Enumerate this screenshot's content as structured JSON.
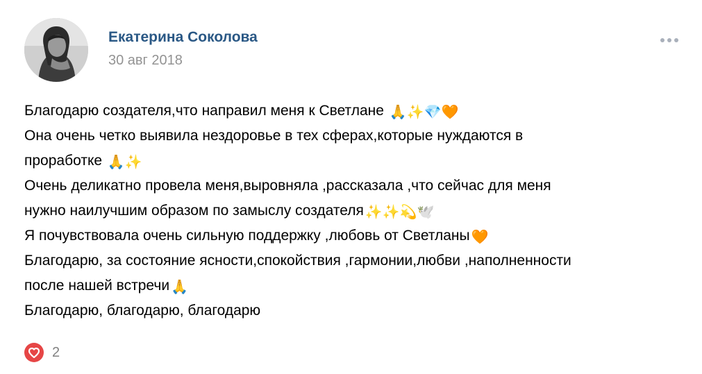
{
  "post": {
    "author": "Екатерина Соколова",
    "date": "30 авг 2018",
    "lines": [
      {
        "text": "Благодарю создателя,что направил меня к Светлане ",
        "emoji": "🙏✨💎🧡"
      },
      {
        "text": "Она очень четко выявила нездоровье в тех сферах,которые нуждаются в",
        "emoji": ""
      },
      {
        "text": "проработке ",
        "emoji": "🙏✨"
      },
      {
        "text": "Очень деликатно провела меня,выровняла ,рассказала ,что сейчас для меня",
        "emoji": ""
      },
      {
        "text": "нужно наилучшим образом по замыслу создателя",
        "emoji": "✨✨💫🕊️"
      },
      {
        "text": "Я почувствовала очень сильную поддержку ,любовь от Светланы",
        "emoji": "🧡"
      },
      {
        "text": "Благодарю, за состояние ясности,спокойствия ,гармонии,любви ,наполненности",
        "emoji": ""
      },
      {
        "text": "после нашей встречи",
        "emoji": "🙏"
      },
      {
        "text": "Благодарю, благодарю, благодарю",
        "emoji": ""
      }
    ],
    "likes": "2"
  },
  "icons": {
    "avatar": "avatar-photo",
    "more": "more-dots-icon",
    "like": "heart-icon"
  },
  "colors": {
    "author_link": "#2a5885",
    "date": "#939393",
    "like_active": "#e64646",
    "like_count": "#828282",
    "more_dots": "#a9b0bb"
  }
}
